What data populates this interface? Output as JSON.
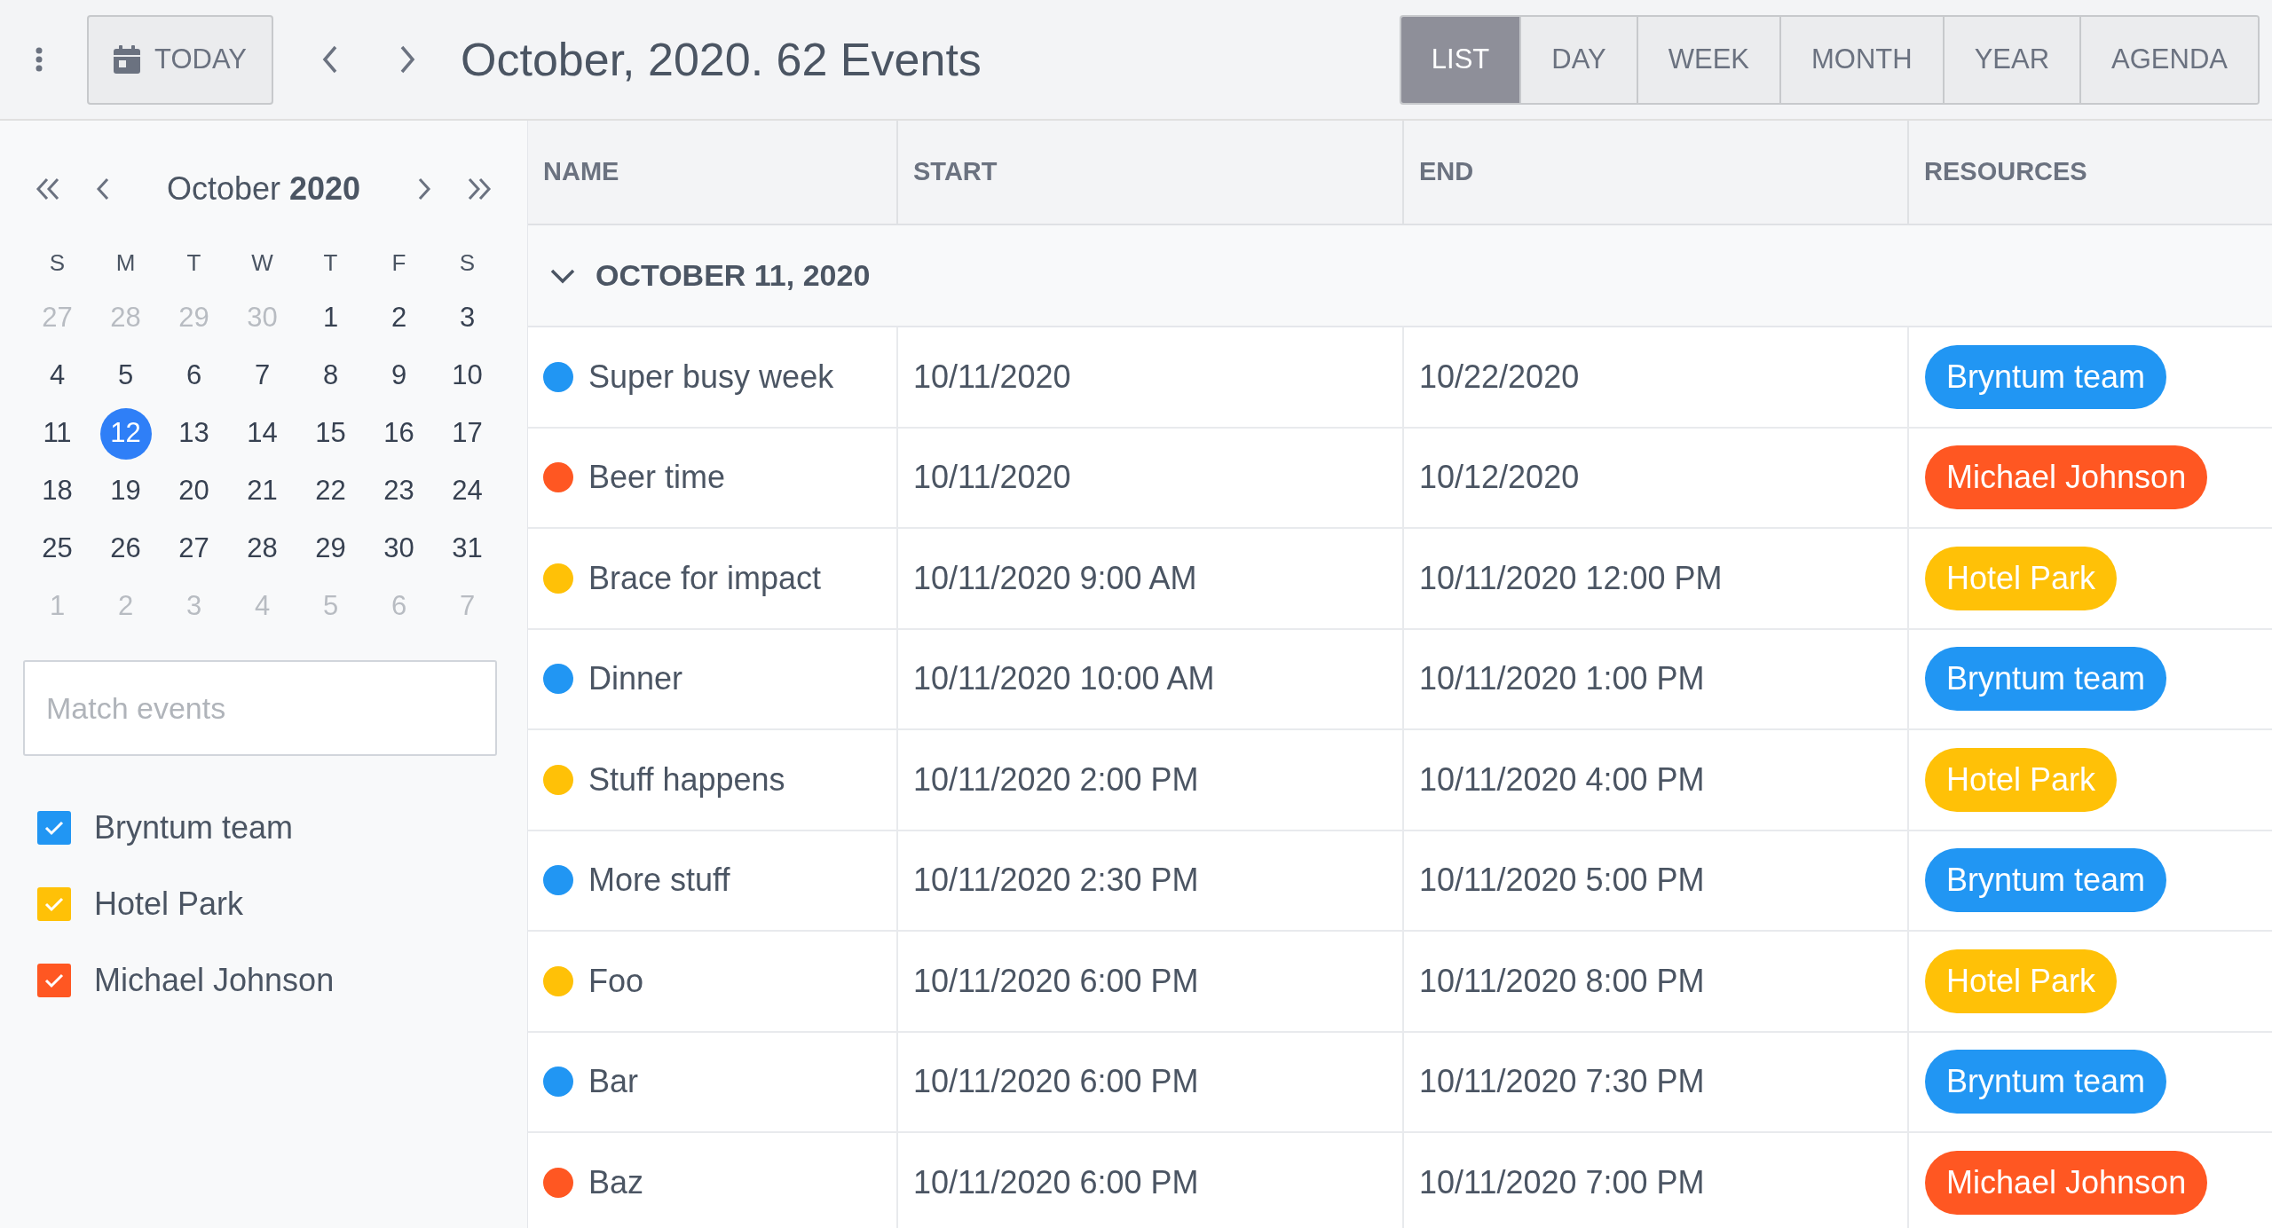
{
  "toolbar": {
    "today": "TODAY",
    "title": "October, 2020. 62 Events",
    "views": [
      {
        "label": "LIST",
        "selected": true
      },
      {
        "label": "DAY",
        "selected": false
      },
      {
        "label": "WEEK",
        "selected": false
      },
      {
        "label": "MONTH",
        "selected": false
      },
      {
        "label": "YEAR",
        "selected": false
      },
      {
        "label": "AGENDA",
        "selected": false
      }
    ]
  },
  "sidebar": {
    "month": "October **2020**",
    "weekdays": [
      "S",
      "M",
      "T",
      "W",
      "T",
      "F",
      "S"
    ],
    "days": [
      {
        "label": "27",
        "other_month": true,
        "selected": false
      },
      {
        "label": "28",
        "other_month": true,
        "selected": false
      },
      {
        "label": "29",
        "other_month": true,
        "selected": false
      },
      {
        "label": "30",
        "other_month": true,
        "selected": false
      },
      {
        "label": "1",
        "other_month": false,
        "selected": false
      },
      {
        "label": "2",
        "other_month": false,
        "selected": false
      },
      {
        "label": "3",
        "other_month": false,
        "selected": false
      },
      {
        "label": "4",
        "other_month": false,
        "selected": false
      },
      {
        "label": "5",
        "other_month": false,
        "selected": false
      },
      {
        "label": "6",
        "other_month": false,
        "selected": false
      },
      {
        "label": "7",
        "other_month": false,
        "selected": false
      },
      {
        "label": "8",
        "other_month": false,
        "selected": false
      },
      {
        "label": "9",
        "other_month": false,
        "selected": false
      },
      {
        "label": "10",
        "other_month": false,
        "selected": false
      },
      {
        "label": "11",
        "other_month": false,
        "selected": false
      },
      {
        "label": "12",
        "other_month": false,
        "selected": true
      },
      {
        "label": "13",
        "other_month": false,
        "selected": false
      },
      {
        "label": "14",
        "other_month": false,
        "selected": false
      },
      {
        "label": "15",
        "other_month": false,
        "selected": false
      },
      {
        "label": "16",
        "other_month": false,
        "selected": false
      },
      {
        "label": "17",
        "other_month": false,
        "selected": false
      },
      {
        "label": "18",
        "other_month": false,
        "selected": false
      },
      {
        "label": "19",
        "other_month": false,
        "selected": false
      },
      {
        "label": "20",
        "other_month": false,
        "selected": false
      },
      {
        "label": "21",
        "other_month": false,
        "selected": false
      },
      {
        "label": "22",
        "other_month": false,
        "selected": false
      },
      {
        "label": "23",
        "other_month": false,
        "selected": false
      },
      {
        "label": "24",
        "other_month": false,
        "selected": false
      },
      {
        "label": "25",
        "other_month": false,
        "selected": false
      },
      {
        "label": "26",
        "other_month": false,
        "selected": false
      },
      {
        "label": "27",
        "other_month": false,
        "selected": false
      },
      {
        "label": "28",
        "other_month": false,
        "selected": false
      },
      {
        "label": "29",
        "other_month": false,
        "selected": false
      },
      {
        "label": "30",
        "other_month": false,
        "selected": false
      },
      {
        "label": "31",
        "other_month": false,
        "selected": false
      },
      {
        "label": "1",
        "other_month": true,
        "selected": false
      },
      {
        "label": "2",
        "other_month": true,
        "selected": false
      },
      {
        "label": "3",
        "other_month": true,
        "selected": false
      },
      {
        "label": "4",
        "other_month": true,
        "selected": false
      },
      {
        "label": "5",
        "other_month": true,
        "selected": false
      },
      {
        "label": "6",
        "other_month": true,
        "selected": false
      },
      {
        "label": "7",
        "other_month": true,
        "selected": false
      }
    ],
    "search": {
      "placeholder": "Match events"
    },
    "resources": [
      {
        "name": "Bryntum team",
        "color": "#2196f3",
        "checked": true
      },
      {
        "name": "Hotel Park",
        "color": "#ffc107",
        "checked": true
      },
      {
        "name": "Michael Johnson",
        "color": "#ff5722",
        "checked": true
      }
    ]
  },
  "table": {
    "columns": [
      "NAME",
      "START",
      "END",
      "RESOURCES"
    ],
    "group": {
      "label": "OCTOBER 11, 2020",
      "expanded": true
    },
    "rows": [
      {
        "name": "Super busy week",
        "start": "10/11/2020",
        "end": "10/22/2020",
        "resource": "Bryntum team",
        "color": "#2196f3"
      },
      {
        "name": "Beer time",
        "start": "10/11/2020",
        "end": "10/12/2020",
        "resource": "Michael Johnson",
        "color": "#ff5722"
      },
      {
        "name": "Brace for impact",
        "start": "10/11/2020 9:00 AM",
        "end": "10/11/2020 12:00 PM",
        "resource": "Hotel Park",
        "color": "#ffc107"
      },
      {
        "name": "Dinner",
        "start": "10/11/2020 10:00 AM",
        "end": "10/11/2020 1:00 PM",
        "resource": "Bryntum team",
        "color": "#2196f3"
      },
      {
        "name": "Stuff happens",
        "start": "10/11/2020 2:00 PM",
        "end": "10/11/2020 4:00 PM",
        "resource": "Hotel Park",
        "color": "#ffc107"
      },
      {
        "name": "More stuff",
        "start": "10/11/2020 2:30 PM",
        "end": "10/11/2020 5:00 PM",
        "resource": "Bryntum team",
        "color": "#2196f3"
      },
      {
        "name": "Foo",
        "start": "10/11/2020 6:00 PM",
        "end": "10/11/2020 8:00 PM",
        "resource": "Hotel Park",
        "color": "#ffc107"
      },
      {
        "name": "Bar",
        "start": "10/11/2020 6:00 PM",
        "end": "10/11/2020 7:30 PM",
        "resource": "Bryntum team",
        "color": "#2196f3"
      },
      {
        "name": "Baz",
        "start": "10/11/2020 6:00 PM",
        "end": "10/11/2020 7:00 PM",
        "resource": "Michael Johnson",
        "color": "#ff5722"
      }
    ]
  }
}
